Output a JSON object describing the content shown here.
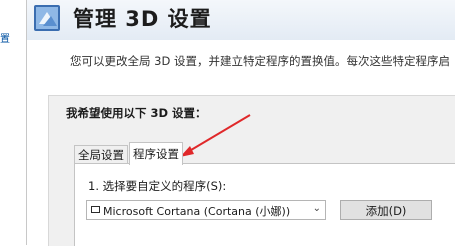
{
  "left_fragment": "置",
  "header": {
    "title": "管理 3D 设置",
    "icon": "3d-settings-icon"
  },
  "description": "您可以更改全局 3D 设置，并建立特定程序的置换值。每次这些特定程序启",
  "panel": {
    "heading": "我希望使用以下 3D 设置："
  },
  "tabs": [
    {
      "label": "全局设置",
      "active": false
    },
    {
      "label": "程序设置",
      "active": true
    }
  ],
  "program_settings": {
    "step1_label": "1. 选择要自定义的程序(S):",
    "selected_program": "Microsoft Cortana (Cortana (小娜))",
    "add_button": "添加(D)"
  },
  "colors": {
    "annotation_arrow": "#e0282a"
  }
}
